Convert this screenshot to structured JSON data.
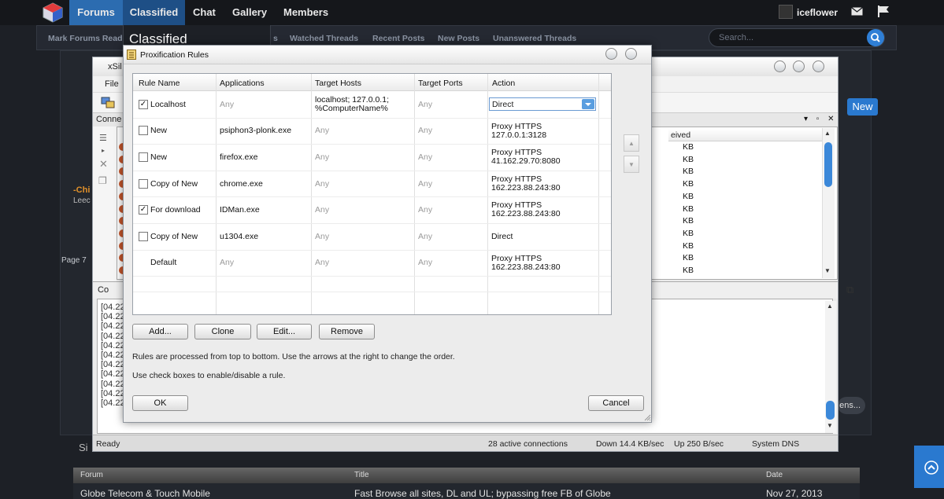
{
  "forum": {
    "nav": [
      "Forums",
      "Classified",
      "Chat",
      "Gallery",
      "Members"
    ],
    "user": "iceflower",
    "subnav": [
      "Mark Forums Read",
      "Watched Threads",
      "Recent Posts",
      "New Posts",
      "Unanswered Threads"
    ],
    "classified_heading": "Classified",
    "subnav_partial": "s",
    "search_placeholder": "Search...",
    "new_badge": "New",
    "page_label": "Page 7",
    "chi_label": "-Chi",
    "lee_label": "Leec",
    "ens_button": "ens...",
    "si_label": "Si",
    "threads": {
      "headers": [
        "Forum",
        "Title",
        "Date"
      ],
      "row": [
        "Globe Telecom & Touch Mobile",
        "Fast Browse all sites, DL and UL; bypassing free FB of Globe",
        "Nov 27, 2013"
      ]
    }
  },
  "xsilent": {
    "title": "xSil",
    "menu_file": "File",
    "conn_tab": "Conne",
    "received_header": "eived",
    "kb_unit": "KB",
    "kb_rows": 11,
    "log_tab": "Co",
    "log_prefix": "[04.22",
    "log_lines": 11,
    "status": {
      "ready": "Ready",
      "connections": "28 active connections",
      "down": "Down 14.4 KB/sec",
      "up": "Up 250 B/sec",
      "dns": "System DNS"
    }
  },
  "dialog": {
    "title": "Proxification Rules",
    "columns": [
      "Rule Name",
      "Applications",
      "Target Hosts",
      "Target Ports",
      "Action"
    ],
    "rules": [
      {
        "checked": true,
        "name": "Localhost",
        "app": "Any",
        "hosts": [
          "localhost; 127.0.0.1;",
          "%ComputerName%"
        ],
        "ports": "Any",
        "action": [
          "Direct"
        ]
      },
      {
        "checked": false,
        "name": "New",
        "app": "psiphon3-plonk.exe",
        "hosts": [
          "Any"
        ],
        "ports": "Any",
        "action": [
          "Proxy HTTPS",
          "127.0.0.1:3128"
        ]
      },
      {
        "checked": false,
        "name": "New",
        "app": "firefox.exe",
        "hosts": [
          "Any"
        ],
        "ports": "Any",
        "action": [
          "Proxy HTTPS",
          "41.162.29.70:8080"
        ]
      },
      {
        "checked": false,
        "name": "Copy of New",
        "app": "chrome.exe",
        "hosts": [
          "Any"
        ],
        "ports": "Any",
        "action": [
          "Proxy HTTPS",
          "162.223.88.243:80"
        ]
      },
      {
        "checked": true,
        "name": "For download",
        "app": "IDMan.exe",
        "hosts": [
          "Any"
        ],
        "ports": "Any",
        "action": [
          "Proxy HTTPS",
          "162.223.88.243:80"
        ]
      },
      {
        "checked": false,
        "name": "Copy of New",
        "app": "u1304.exe",
        "hosts": [
          "Any"
        ],
        "ports": "Any",
        "action": [
          "Direct"
        ]
      },
      {
        "checked": null,
        "name": "Default",
        "app": "Any",
        "hosts": [
          "Any"
        ],
        "ports": "Any",
        "action": [
          "Proxy HTTPS",
          "162.223.88.243:80"
        ]
      }
    ],
    "selected_action": "Direct",
    "buttons": {
      "add": "Add...",
      "clone": "Clone",
      "edit": "Edit...",
      "remove": "Remove",
      "ok": "OK",
      "cancel": "Cancel"
    },
    "note_order": "Rules are processed from top to bottom. Use the arrows at the right to change the order.",
    "note_check": "Use check boxes to enable/disable a rule."
  }
}
